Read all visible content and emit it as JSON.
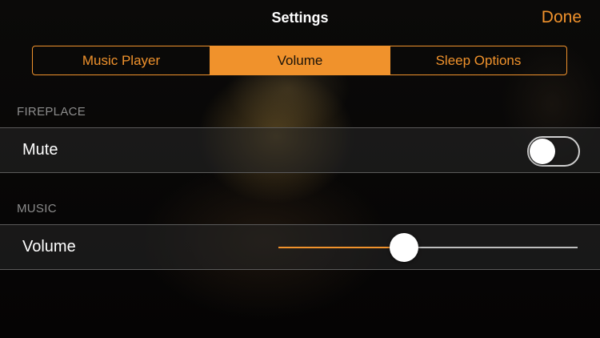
{
  "nav": {
    "title": "Settings",
    "done_label": "Done"
  },
  "tabs": [
    {
      "label": "Music Player",
      "active": false
    },
    {
      "label": "Volume",
      "active": true
    },
    {
      "label": "Sleep Options",
      "active": false
    }
  ],
  "fireplace": {
    "header": "FIREPLACE",
    "mute_label": "Mute",
    "mute_on": false
  },
  "music": {
    "header": "MUSIC",
    "volume_label": "Volume",
    "volume_level": 0.42
  },
  "colors": {
    "accent": "#f0922c",
    "row_background": "#282828",
    "text": "#ffffff",
    "section_header": "#8c8c8c"
  }
}
